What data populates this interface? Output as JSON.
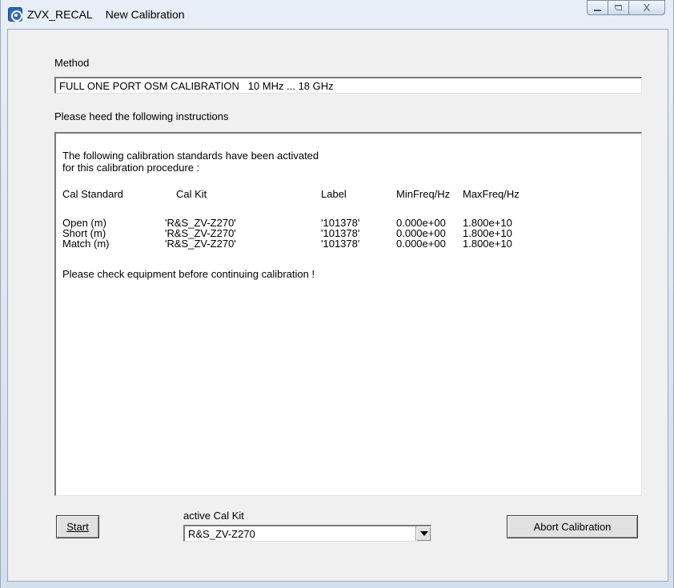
{
  "titlebar": {
    "app_name": "ZVX_RECAL",
    "title": "New Calibration",
    "icon": "app-icon",
    "controls": {
      "minimize": "minimize-icon",
      "maximize": "maximize-icon",
      "close": "X"
    }
  },
  "method": {
    "label": "Method",
    "value": "FULL ONE PORT OSM CALIBRATION   10 MHz ... 18 GHz"
  },
  "instructions": {
    "label": "Please heed the following instructions",
    "intro_line1": "The following calibration standards have been activated",
    "intro_line2": "for this calibration procedure :",
    "headers": {
      "cal_standard": "Cal Standard",
      "cal_kit": "Cal Kit",
      "label": "Label",
      "min_freq": "MinFreq/Hz",
      "max_freq": "MaxFreq/Hz"
    },
    "rows": [
      {
        "cal_standard": "Open (m)",
        "cal_kit": "'R&S_ZV-Z270'",
        "label": "'101378'",
        "min_freq": "0.000e+00",
        "max_freq": "1.800e+10"
      },
      {
        "cal_standard": "Short (m)",
        "cal_kit": "'R&S_ZV-Z270'",
        "label": "'101378'",
        "min_freq": "0.000e+00",
        "max_freq": "1.800e+10"
      },
      {
        "cal_standard": "Match (m)",
        "cal_kit": "'R&S_ZV-Z270'",
        "label": "'101378'",
        "min_freq": "0.000e+00",
        "max_freq": "1.800e+10"
      }
    ],
    "footer": "Please check equipment before continuing calibration !"
  },
  "controls": {
    "start_label": "Start",
    "cal_kit_label": "active Cal Kit",
    "cal_kit_value": "R&S_ZV-Z270",
    "abort_label": "Abort Calibration"
  }
}
